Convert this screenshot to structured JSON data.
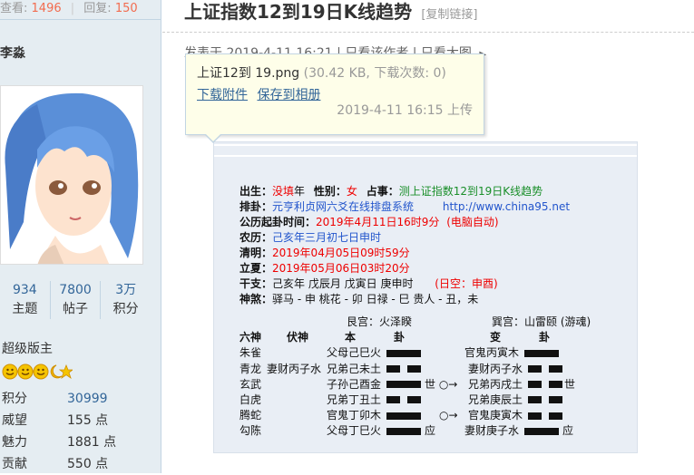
{
  "sidebar": {
    "stats": {
      "view_label": "查看:",
      "views": "1496",
      "reply_label": "回复:",
      "replies": "150"
    },
    "username": "李淼",
    "counts": [
      {
        "value": "934",
        "label": "主题"
      },
      {
        "value": "7800",
        "label": "帖子"
      },
      {
        "value": "3万",
        "label": "积分"
      }
    ],
    "group": "超级版主",
    "info": [
      {
        "key": "积分",
        "value": "30999"
      },
      {
        "key": "威望",
        "value": "155 点"
      },
      {
        "key": "魅力",
        "value": "1881 点"
      },
      {
        "key": "贡献",
        "value": "550 点"
      }
    ]
  },
  "post": {
    "title": "上证指数12到19日K线趋势",
    "copy_link": "[复制链接]",
    "meta": "发表于 2019-4-11 16:21  |  只看该作者  |  只看大图"
  },
  "attachment_tip": {
    "filename": "上证12到 19.png",
    "size": "(30.42 KB, 下载次数: 0)",
    "download": "下载附件",
    "save": "保存到相册",
    "date": "2019-4-11 16:15 上传"
  },
  "divination": {
    "line1": {
      "l1": "出生：",
      "v1": "没填",
      "t1": "年",
      "l2": "性别：",
      "v2": "女",
      "l3": "占事：",
      "v3": "测上证指数12到19日K线趋势"
    },
    "line2": {
      "l": "排卦：",
      "v": "元亨利贞网六爻在线排盘系统",
      "url": "http://www.china95.net"
    },
    "line3": {
      "l": "公历起卦时间：",
      "v": "2019年4月11日16时9分",
      "note": "(电脑自动)"
    },
    "line4": {
      "l": "农历：",
      "v": "己亥年三月初七日申时"
    },
    "line5": {
      "l": "清明：",
      "v": "2019年04月05日09时59分"
    },
    "line6": {
      "l": "立夏：",
      "v": "2019年05月06日03时20分"
    },
    "line7": {
      "l": "干支：",
      "v": "己亥年  戊辰月  戊寅日  庚申时",
      "kong": "(日空：申酉)"
    },
    "line8": {
      "l": "神煞：",
      "v": "驿马 - 申   桃花 - 卯   日禄 - 巳   贵人 - 丑，未"
    },
    "header1": "艮宫：火泽睽",
    "header2": "巽宫：山雷颐 (游魂)",
    "col_headers": [
      "六神",
      "伏神",
      "本",
      "卦",
      "变",
      "卦"
    ],
    "rows": [
      {
        "shen": "朱雀",
        "fu": "",
        "ben": "父母己巳火",
        "mark": "",
        "bian": "官鬼丙寅木"
      },
      {
        "shen": "青龙",
        "fu": "妻财丙子水",
        "ben": "兄弟己未土",
        "mark": "",
        "bian": "妻财丙子水"
      },
      {
        "shen": "玄武",
        "fu": "",
        "ben": "子孙己酉金",
        "mark": "世 ○→",
        "bian": "兄弟丙戌土",
        "mark2": "世"
      },
      {
        "shen": "白虎",
        "fu": "",
        "ben": "兄弟丁丑土",
        "mark": "",
        "bian": "兄弟庚辰土"
      },
      {
        "shen": "腾蛇",
        "fu": "",
        "ben": "官鬼丁卯木",
        "mark": "○→",
        "bian": "官鬼庚寅木"
      },
      {
        "shen": "勾陈",
        "fu": "",
        "ben": "父母丁巳火",
        "mark": "应",
        "bian": "妻财庚子水",
        "mark2": "应"
      }
    ]
  }
}
